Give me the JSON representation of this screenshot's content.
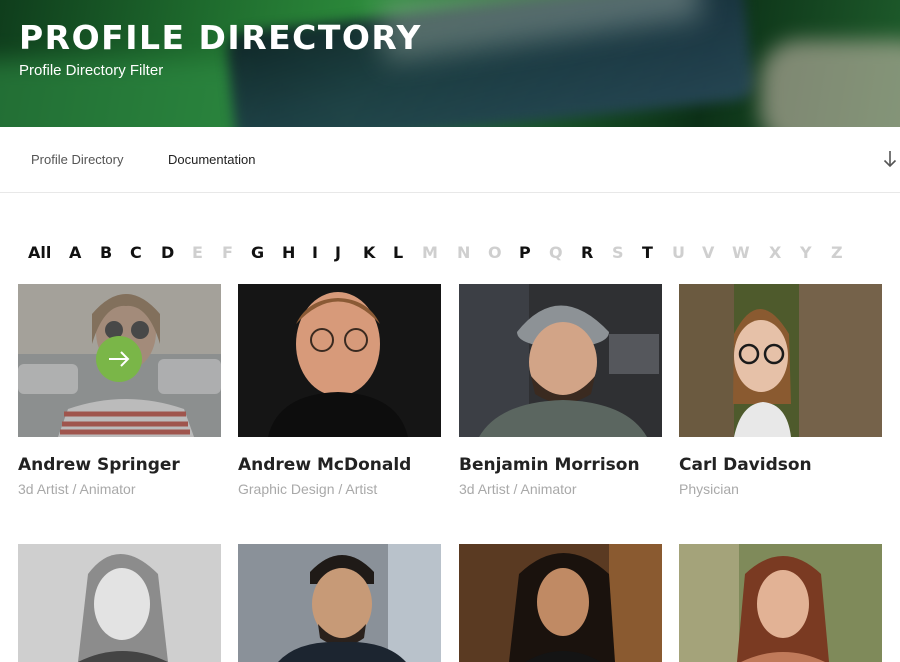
{
  "header": {
    "title": "PROFILE DIRECTORY",
    "subtitle": "Profile Directory Filter"
  },
  "nav": {
    "items": [
      {
        "label": "Profile Directory"
      },
      {
        "label": "Documentation"
      }
    ],
    "scroll_icon": "arrow-down-icon"
  },
  "alphabet": {
    "letters": [
      {
        "label": "All",
        "enabled": true
      },
      {
        "label": "A",
        "enabled": true
      },
      {
        "label": "B",
        "enabled": true
      },
      {
        "label": "C",
        "enabled": true
      },
      {
        "label": "D",
        "enabled": true
      },
      {
        "label": "E",
        "enabled": false
      },
      {
        "label": "F",
        "enabled": false
      },
      {
        "label": "G",
        "enabled": true
      },
      {
        "label": "H",
        "enabled": true
      },
      {
        "label": "I",
        "enabled": true
      },
      {
        "label": "J",
        "enabled": true
      },
      {
        "label": "K",
        "enabled": true
      },
      {
        "label": "L",
        "enabled": true
      },
      {
        "label": "M",
        "enabled": false
      },
      {
        "label": "N",
        "enabled": false
      },
      {
        "label": "O",
        "enabled": false
      },
      {
        "label": "P",
        "enabled": true
      },
      {
        "label": "Q",
        "enabled": false
      },
      {
        "label": "R",
        "enabled": true
      },
      {
        "label": "S",
        "enabled": false
      },
      {
        "label": "T",
        "enabled": true
      },
      {
        "label": "U",
        "enabled": false
      },
      {
        "label": "V",
        "enabled": false
      },
      {
        "label": "W",
        "enabled": false
      },
      {
        "label": "X",
        "enabled": false
      },
      {
        "label": "Y",
        "enabled": false
      },
      {
        "label": "Z",
        "enabled": false
      }
    ]
  },
  "profiles": [
    {
      "name": "Andrew Springer",
      "role": "3d Artist / Animator",
      "hovered": true
    },
    {
      "name": "Andrew McDonald",
      "role": "Graphic Design / Artist",
      "hovered": false
    },
    {
      "name": "Benjamin Morrison",
      "role": "3d Artist / Animator",
      "hovered": false
    },
    {
      "name": "Carl Davidson",
      "role": "Physician",
      "hovered": false
    },
    {
      "name": "",
      "role": "",
      "hovered": false
    },
    {
      "name": "",
      "role": "",
      "hovered": false
    },
    {
      "name": "",
      "role": "",
      "hovered": false
    },
    {
      "name": "",
      "role": "",
      "hovered": false
    }
  ],
  "colors": {
    "accent_button": "#7ab648",
    "disabled_letter": "#cfcfcf",
    "role_text": "#a9a9a9"
  },
  "icons": {
    "card_action": "arrow-right-icon"
  }
}
